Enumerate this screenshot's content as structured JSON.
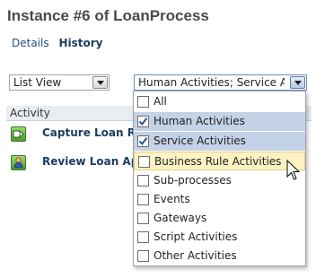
{
  "page": {
    "title": "Instance #6 of LoanProcess"
  },
  "tabs": [
    {
      "label": "Details"
    },
    {
      "label": "History"
    }
  ],
  "view_select": {
    "value": "List View"
  },
  "filter_select": {
    "value": "Human Activities; Service Activ"
  },
  "table": {
    "column_header": "Activity",
    "rows": [
      {
        "label": "Capture Loan Re",
        "icon": "service-activity-icon"
      },
      {
        "label": "Review Loan App",
        "icon": "human-activity-icon"
      }
    ]
  },
  "dropdown": {
    "options": [
      {
        "label": "All",
        "checked": false
      },
      {
        "label": "Human Activities",
        "checked": true
      },
      {
        "label": "Service Activities",
        "checked": true
      },
      {
        "label": "Business Rule Activities",
        "checked": false,
        "hovered": true
      },
      {
        "label": "Sub-processes",
        "checked": false
      },
      {
        "label": "Events",
        "checked": false
      },
      {
        "label": "Gateways",
        "checked": false
      },
      {
        "label": "Script Activities",
        "checked": false
      },
      {
        "label": "Other Activities",
        "checked": false
      }
    ]
  },
  "colors": {
    "title": "#4a4a4a",
    "link": "#1f3b63",
    "checked_row_bg": "#c3d2e6",
    "hover_row_bg": "#fdf2c4"
  }
}
